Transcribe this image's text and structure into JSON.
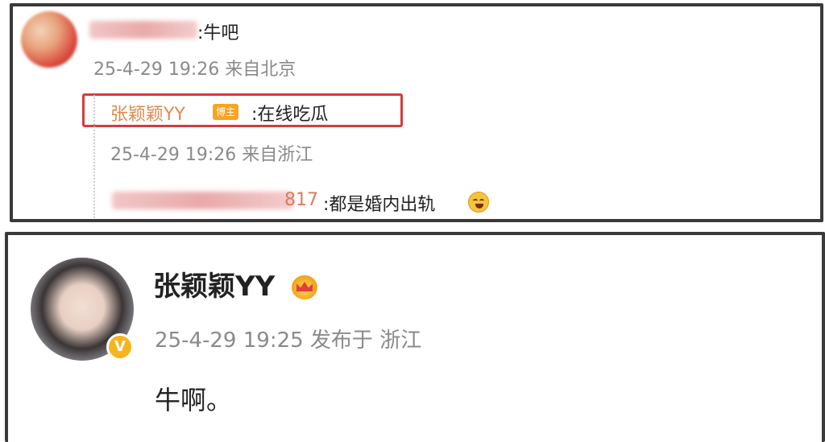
{
  "comment": {
    "text": ":牛吧",
    "time": "25-4-29 19:26 来自北京"
  },
  "reply1": {
    "name": "张颖颖YY",
    "badge": "博主",
    "text": ":在线吃瓜",
    "time": "25-4-29 19:26 来自浙江"
  },
  "reply2": {
    "name_suffix": "817",
    "text": ":都是婚内出轨",
    "emoji": "laugh-cry-icon"
  },
  "post": {
    "name": "张颖颖YY",
    "meta": "25-4-29 19:25 发布于 浙江",
    "body": "牛啊。",
    "verify_mark": "V"
  },
  "colors": {
    "highlight_border": "#d93a3a",
    "reply_name": "#e08a4f",
    "badge_bg": "#f5a623",
    "time_text": "#8a8a8a"
  }
}
